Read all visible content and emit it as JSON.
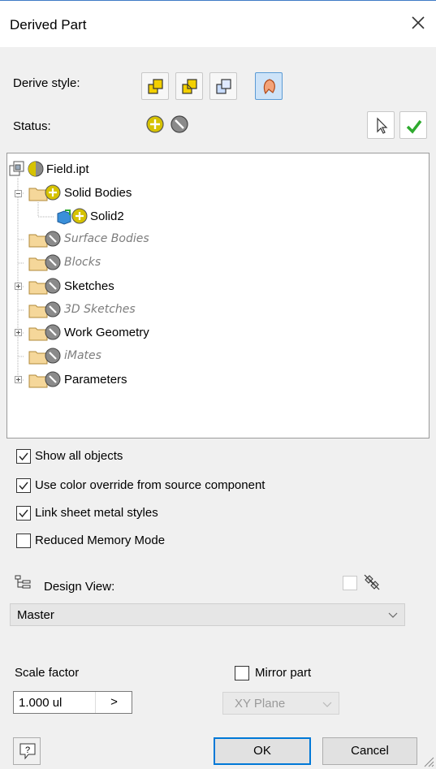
{
  "window": {
    "title": "Derived Part"
  },
  "derive": {
    "label": "Derive style:"
  },
  "status": {
    "label": "Status:"
  },
  "tree": {
    "root": "Field.ipt",
    "solid_bodies": "Solid Bodies",
    "solid2": "Solid2",
    "surface_bodies": "Surface Bodies",
    "blocks": "Blocks",
    "sketches": "Sketches",
    "sketches3d": "3D Sketches",
    "work_geometry": "Work Geometry",
    "imates": "iMates",
    "parameters": "Parameters"
  },
  "options": {
    "show_all": "Show all objects",
    "color_override": "Use color override from source component",
    "sheet_metal": "Link sheet metal styles",
    "reduced_memory": "Reduced Memory Mode"
  },
  "design_view": {
    "label": "Design View:",
    "value": "Master"
  },
  "scale": {
    "label": "Scale factor",
    "value": "1.000 ul",
    "arrow": ">"
  },
  "mirror": {
    "label": "Mirror part",
    "plane": "XY Plane"
  },
  "buttons": {
    "ok": "OK",
    "cancel": "Cancel",
    "help": "?"
  },
  "colors": {
    "accent": "#0078d7",
    "include": "#d6c200",
    "exclude": "#6e6e6e",
    "check_green": "#2eaa2e"
  }
}
